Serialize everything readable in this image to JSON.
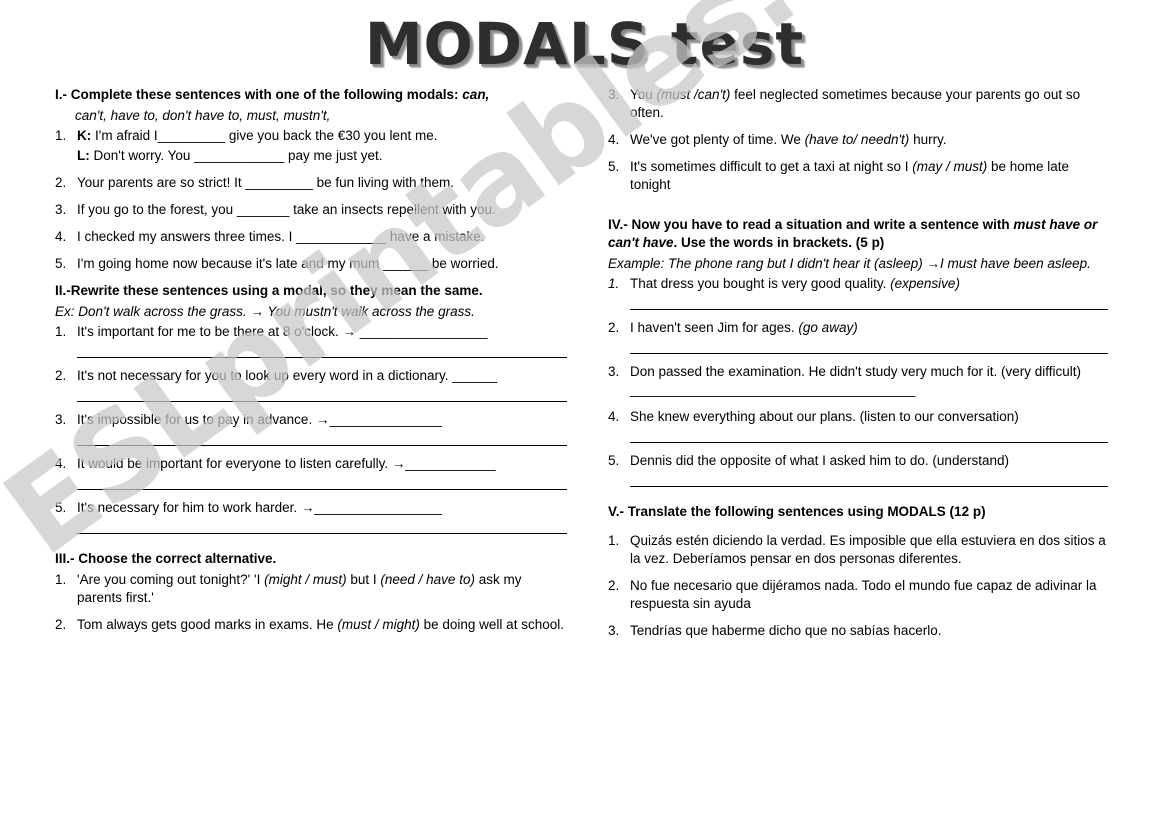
{
  "title": "MODALS test",
  "watermark": "ESLprintables.com",
  "sections": {
    "one": {
      "heading_bold": "I.- Complete these sentences with one of the following modals:",
      "heading_italic": " can,",
      "heading_line2": "can't, have to, don't have to, must, mustn't,",
      "items": [
        {
          "num": "1.",
          "speaker_a": "K:",
          "text_a": " I'm afraid I_________ give you back the €30 you lent me.",
          "speaker_b": "L:",
          "text_b": " Don't worry. You ____________ pay me just yet."
        },
        {
          "num": "2.",
          "text": "Your parents are so strict! It _________ be fun living with them."
        },
        {
          "num": "3.",
          "text": "If you go to the forest, you _______ take an insects repellent with you."
        },
        {
          "num": "4.",
          "text": "I checked my answers three times. I ____________ have a mistake."
        },
        {
          "num": "5.",
          "text": "I'm going home now because it's late and my mum ______ be worried."
        }
      ]
    },
    "two": {
      "heading": "II.-Rewrite these sentences using a modal, so they mean the same.",
      "example": "Ex: Don't walk across the grass. → You mustn't walk across the grass.",
      "items": [
        {
          "num": "1.",
          "text": "It's important for me to be there at 8 o'clock. → _________________"
        },
        {
          "num": "2.",
          "text": "It's not necessary for you to look up every word in a dictionary. ______"
        },
        {
          "num": "3.",
          "text": "It's impossible for us to pay in advance. →_______________"
        },
        {
          "num": "4.",
          "text": "It would be important for everyone to listen carefully. →____________"
        },
        {
          "num": "5.",
          "text": "It's necessary for him to work harder. →_________________"
        }
      ]
    },
    "three": {
      "heading": "III.- Choose the correct alternative.",
      "items": [
        {
          "num": "1.",
          "parts": [
            {
              "t": "'Are you coming out tonight?' 'I ",
              "i": false
            },
            {
              "t": "(might / must)",
              "i": true
            },
            {
              "t": " but I ",
              "i": false
            },
            {
              "t": "(need / have to)",
              "i": true
            },
            {
              "t": " ask my parents first.'",
              "i": false
            }
          ]
        },
        {
          "num": "2.",
          "parts": [
            {
              "t": "Tom always gets good marks in exams. He ",
              "i": false
            },
            {
              "t": "(must / might)",
              "i": true
            },
            {
              "t": " be doing well at school.",
              "i": false
            }
          ]
        },
        {
          "num": "3.",
          "parts": [
            {
              "t": "You ",
              "i": false
            },
            {
              "t": "(must /can't)",
              "i": true
            },
            {
              "t": " feel neglected sometimes because your parents go out so often.",
              "i": false
            }
          ]
        },
        {
          "num": "4.",
          "parts": [
            {
              "t": "We've got plenty of time. We ",
              "i": false
            },
            {
              "t": "(have to/ needn't)",
              "i": true
            },
            {
              "t": "  hurry.",
              "i": false
            }
          ]
        },
        {
          "num": "5.",
          "parts": [
            {
              "t": "It's sometimes difficult to get a taxi at night so I ",
              "i": false
            },
            {
              "t": "(may / must)",
              "i": true
            },
            {
              "t": " be home late tonight",
              "i": false
            }
          ]
        }
      ]
    },
    "four": {
      "heading_part1": "IV.- Now you have to read a situation and write a sentence with ",
      "heading_italic1": "must have or can't have",
      "heading_part2": ". Use the words in brackets. (5 p)",
      "example": "Example: The phone rang but I didn't hear it (asleep) →I must have been asleep.",
      "items": [
        {
          "num": "1.",
          "text": "That dress you bought is very good quality.  ",
          "bracket": "(expensive)",
          "inline_rule": false
        },
        {
          "num": "2.",
          "text": "I haven't seen Jim for ages. ",
          "bracket": "(go away)",
          "inline_rule": false
        },
        {
          "num": "3.",
          "text": "Don passed the examination. He didn't study very much for it. (very difficult) ______________________________________",
          "bracket": "",
          "inline_rule": true
        },
        {
          "num": "4.",
          "text": "She knew everything about our plans. (listen to our conversation)",
          "bracket": "",
          "inline_rule": false
        },
        {
          "num": "5.",
          "text": "Dennis did the opposite of what I asked him to do. (understand)",
          "bracket": "",
          "inline_rule": false
        }
      ]
    },
    "five": {
      "heading": "V.- Translate the following sentences using MODALS (12 p)",
      "items": [
        {
          "num": "1.",
          "text": "Quizás estén diciendo la verdad. Es imposible que ella estuviera en dos sitios a la vez. Deberíamos pensar en dos personas diferentes."
        },
        {
          "num": "2.",
          "text": "No fue necesario que dijéramos nada. Todo el mundo fue capaz de adivinar la respuesta sin ayuda"
        },
        {
          "num": "3.",
          "text": "Tendrías que haberme dicho que no sabías hacerlo."
        }
      ]
    }
  }
}
